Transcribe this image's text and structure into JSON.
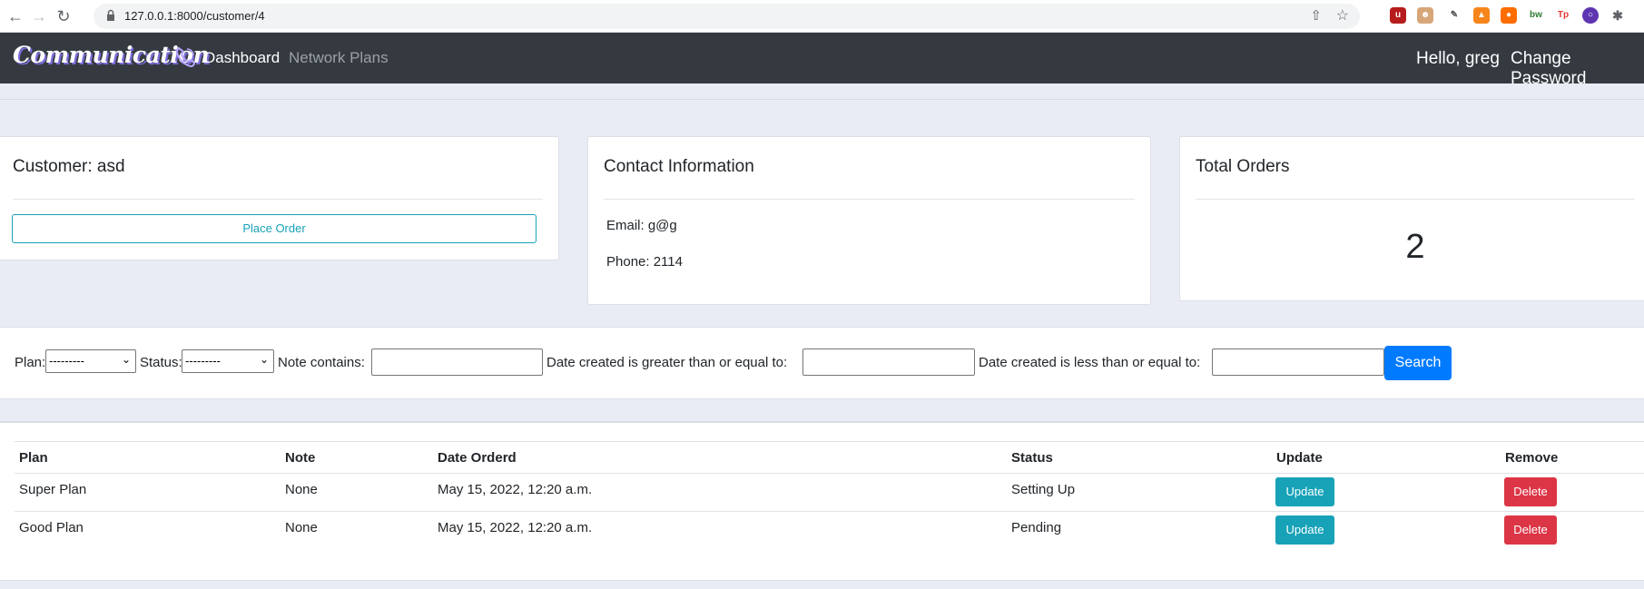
{
  "browser": {
    "url": "127.0.0.1:8000/customer/4"
  },
  "navbar": {
    "brand": "Communication",
    "links": [
      "Dashboard",
      "Network Plans"
    ],
    "greeting": "Hello, greg",
    "change_password": "Change Password"
  },
  "customer_card": {
    "title": "Customer: asd",
    "place_order": "Place Order"
  },
  "contact_card": {
    "title": "Contact Information",
    "email": "Email: g@g",
    "phone": "Phone: 2114"
  },
  "orders_card": {
    "title": "Total Orders",
    "count": "2"
  },
  "filter": {
    "plan_label": "Plan:",
    "plan_value": "---------",
    "status_label": "Status:",
    "status_value": "---------",
    "note_label": "Note contains:",
    "date_gte_label": "Date created is greater than or equal to:",
    "date_lte_label": "Date created is less than or equal to:",
    "search": "Search"
  },
  "table": {
    "headers": [
      "Plan",
      "Note",
      "Date Orderd",
      "Status",
      "Update",
      "Remove"
    ],
    "rows": [
      {
        "plan": "Super Plan",
        "note": "None",
        "date": "May 15, 2022, 12:20 a.m.",
        "status": "Setting Up",
        "update": "Update",
        "remove": "Delete"
      },
      {
        "plan": "Good Plan",
        "note": "None",
        "date": "May 15, 2022, 12:20 a.m.",
        "status": "Pending",
        "update": "Update",
        "remove": "Delete"
      }
    ]
  },
  "colors": {
    "navbar": "#343a40",
    "info": "#17a2b8",
    "primary": "#007bff",
    "danger": "#dc3545"
  }
}
